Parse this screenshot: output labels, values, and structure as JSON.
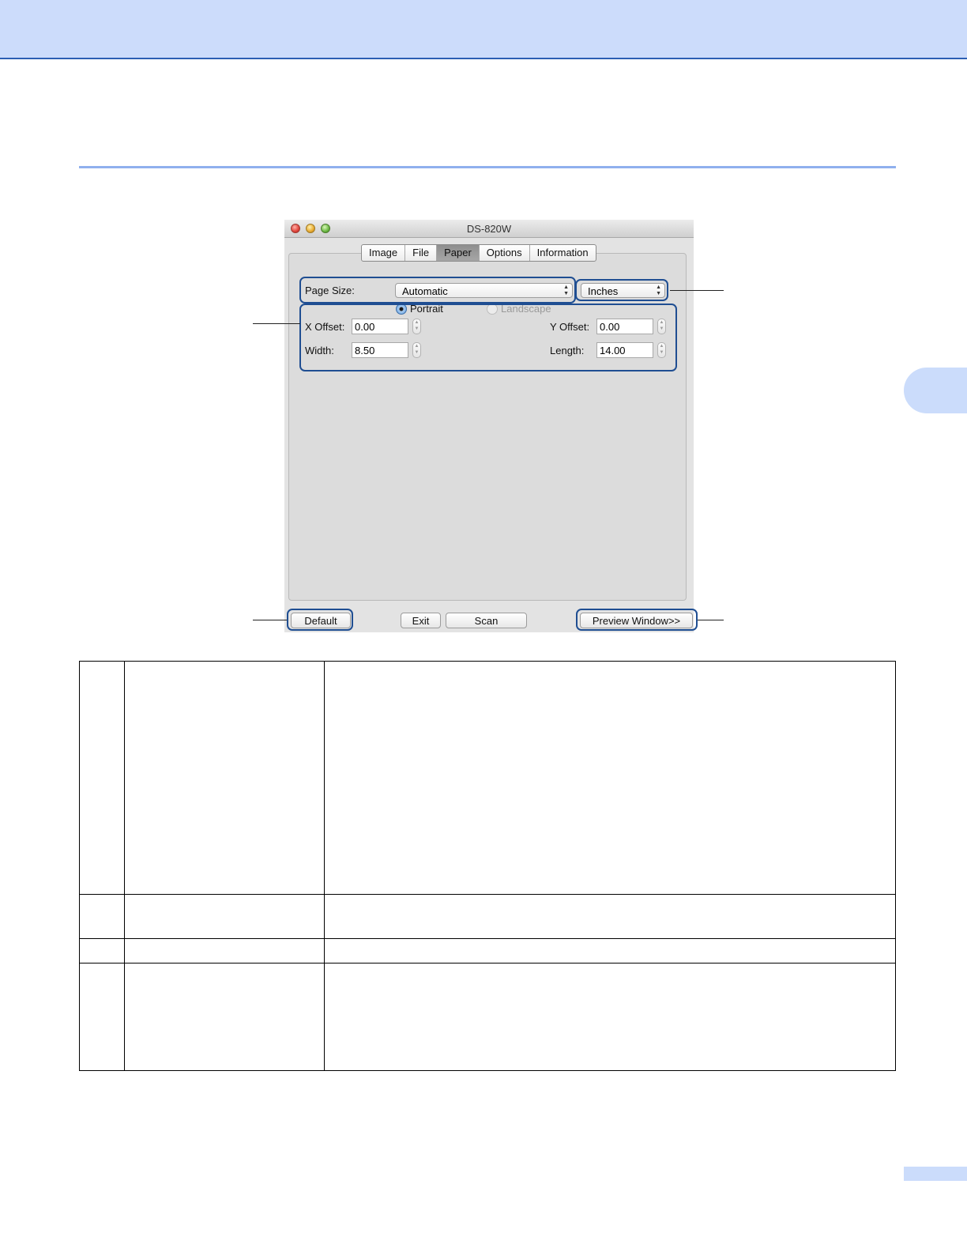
{
  "window": {
    "title": "DS-820W",
    "tabs": [
      {
        "label": "Image"
      },
      {
        "label": "File"
      },
      {
        "label": "Paper"
      },
      {
        "label": "Options"
      },
      {
        "label": "Information"
      }
    ],
    "active_tab": "Paper"
  },
  "paper": {
    "page_size_label": "Page Size:",
    "page_size_value": "Automatic",
    "units_value": "Inches",
    "portrait_label": "Portrait",
    "landscape_label": "Landscape",
    "x_offset_label": "X Offset:",
    "x_offset_value": "0.00",
    "y_offset_label": "Y Offset:",
    "y_offset_value": "0.00",
    "width_label": "Width:",
    "width_value": "8.50",
    "length_label": "Length:",
    "length_value": "14.00"
  },
  "buttons": {
    "default": "Default",
    "exit": "Exit",
    "scan": "Scan",
    "preview": "Preview Window>>"
  },
  "colors": {
    "header_band": "#ccdcfb",
    "accent_rule": "#8fb0ee",
    "highlight": "#1f4e92"
  }
}
